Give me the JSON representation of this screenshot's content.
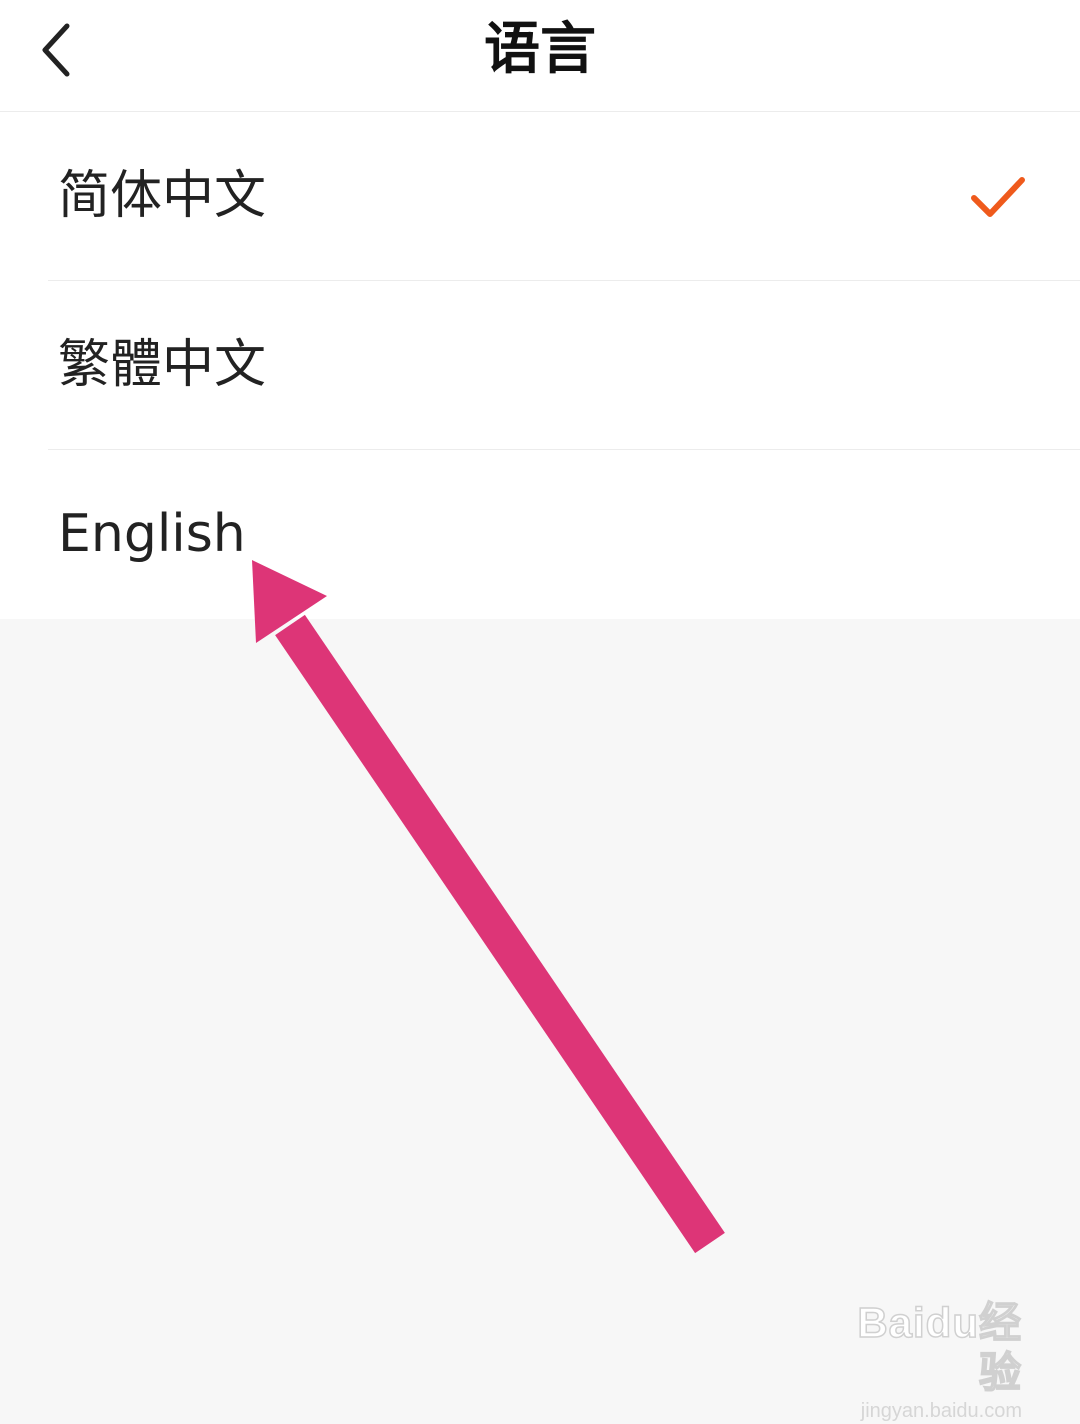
{
  "header": {
    "title": "语言",
    "back_icon": "chevron-left-icon"
  },
  "languages": [
    {
      "label": "简体中文",
      "selected": true
    },
    {
      "label": "繁體中文",
      "selected": false
    },
    {
      "label": "English",
      "selected": false
    }
  ],
  "selected_icon": "checkmark-icon",
  "colors": {
    "accent_check": "#ef5a1c",
    "annotation_arrow": "#dd3577",
    "background": "#f7f7f7"
  },
  "watermark": {
    "logo": "Baidu经验",
    "url": "jingyan.baidu.com"
  }
}
